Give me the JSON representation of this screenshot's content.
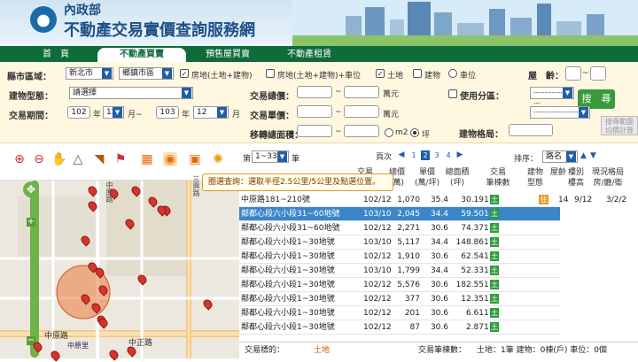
{
  "header": {
    "ministry": "內政部",
    "title": "不動產交易實價查詢服務網"
  },
  "nav": {
    "tabs": [
      {
        "label": "首　頁"
      },
      {
        "label": "不動產買賣"
      },
      {
        "label": "預售屋買賣"
      },
      {
        "label": "不動產租賃"
      }
    ],
    "active_tab": 1
  },
  "search": {
    "county_label": "縣市區域：",
    "county_value": "新北市",
    "district_value": "鄉鎮市區",
    "types": [
      {
        "label": "房地(土地+建物)",
        "checked": true
      },
      {
        "label": "房地(土地+建物)+車位",
        "checked": false
      },
      {
        "label": "土地",
        "checked": true
      },
      {
        "label": "建物",
        "checked": false
      },
      {
        "label": "車位",
        "checked": false
      }
    ],
    "age_label": "屋　齡：",
    "building_type_label": "建物型態：",
    "building_type_value": "請選擇",
    "price_label": "交易總價：",
    "price_unit": "萬元",
    "use_zoning_label": "使用分區：",
    "period_label": "交易期間：",
    "period_from_year": "102",
    "period_from_month": "12",
    "period_to_year": "103",
    "period_to_month": "12",
    "year_label": "年",
    "month_label": "月~",
    "month_end_label": "月",
    "unit_price_label": "交易單價：",
    "unit_price_unit": "萬元",
    "area_label": "移轉總面積：",
    "area_unit_m2": "m2",
    "area_unit_ping": "坪",
    "layout_label": "建物格局：",
    "range_sep": "~",
    "zoning_placeholder": "--------------------",
    "search_button": "搜　尋",
    "range_button_line1": "搜尋範圍",
    "range_button_line2": "均價計算"
  },
  "map": {
    "tooltip": "圈選查詢：選取半徑2.5公里/5公里及點選位置。",
    "road_label": "中原路",
    "road_label2": "中正路",
    "station_label": "中原里",
    "street_vertical1": "中原路",
    "street_vertical2": "三興路"
  },
  "results": {
    "page_label": "第",
    "page_range": "1~33",
    "page_suffix": "筆",
    "pages_label": "頁次",
    "pages": [
      "1",
      "2",
      "3",
      "4"
    ],
    "current_page": "2",
    "sort_label": "排序：",
    "sort_value": "路名",
    "columns": [
      {
        "l1": "",
        "l2": "交易"
      },
      {
        "l1": "總價",
        "l2": "(萬)"
      },
      {
        "l1": "單價",
        "l2": "(萬/坪)"
      },
      {
        "l1": "總面積",
        "l2": "(坪)"
      },
      {
        "l1": "交易",
        "l2": "筆棟數"
      },
      {
        "l1": "建物",
        "l2": "型態"
      },
      {
        "l1": "屋齡",
        "l2": ""
      },
      {
        "l1": "樓別",
        "l2": "樓高"
      },
      {
        "l1": "現況格局",
        "l2": "房/廳/衛"
      }
    ],
    "rows": [
      {
        "address": "中原路181~210號",
        "date": "102/12",
        "total": "1,070",
        "unit": "35.4",
        "area": "30.19",
        "count": "1",
        "age": "14",
        "floor": "9/12",
        "layout": "3/2/2"
      },
      {
        "address": "鄰都心段六小段31~60地號",
        "date": "103/10",
        "total": "2,045",
        "unit": "34.4",
        "area": "59.50",
        "count": "1"
      },
      {
        "address": "鄰都心段六小段31~60地號",
        "date": "102/12",
        "total": "2,271",
        "unit": "30.6",
        "area": "74.37",
        "count": "1"
      },
      {
        "address": "鄰都心段六小段1~30地號",
        "date": "103/10",
        "total": "5,117",
        "unit": "34.4",
        "area": "148.86",
        "count": "1"
      },
      {
        "address": "鄰都心段六小段1~30地號",
        "date": "102/12",
        "total": "1,910",
        "unit": "30.6",
        "area": "62.54",
        "count": "1"
      },
      {
        "address": "鄰都心段六小段1~30地號",
        "date": "103/10",
        "total": "1,799",
        "unit": "34.4",
        "area": "52.33",
        "count": "1"
      },
      {
        "address": "鄰都心段六小段1~30地號",
        "date": "102/12",
        "total": "5,576",
        "unit": "30.6",
        "area": "182.55",
        "count": "1"
      },
      {
        "address": "鄰都心段六小段1~30地號",
        "date": "102/12",
        "total": "377",
        "unit": "30.6",
        "area": "12.35",
        "count": "1"
      },
      {
        "address": "鄰都心段六小段1~30地號",
        "date": "102/12",
        "total": "201",
        "unit": "30.6",
        "area": "6.61",
        "count": "1"
      },
      {
        "address": "鄰都心段六小段1~30地號",
        "date": "102/12",
        "total": "87",
        "unit": "30.6",
        "area": "2.87",
        "count": "1"
      }
    ],
    "detail_icon": "土",
    "building_icon": "住",
    "selected_row": 1,
    "detail_label": "交易標的：",
    "detail_value": "土地",
    "count_label": "交易筆棟數：",
    "count_value": "土地：1筆 建物：0棟(戶) 車位：0個"
  },
  "colors": {
    "brand": "#0e6b3a",
    "accent": "#1f5fa8",
    "selected": "#3a86c8",
    "pin": "#d9342b"
  }
}
